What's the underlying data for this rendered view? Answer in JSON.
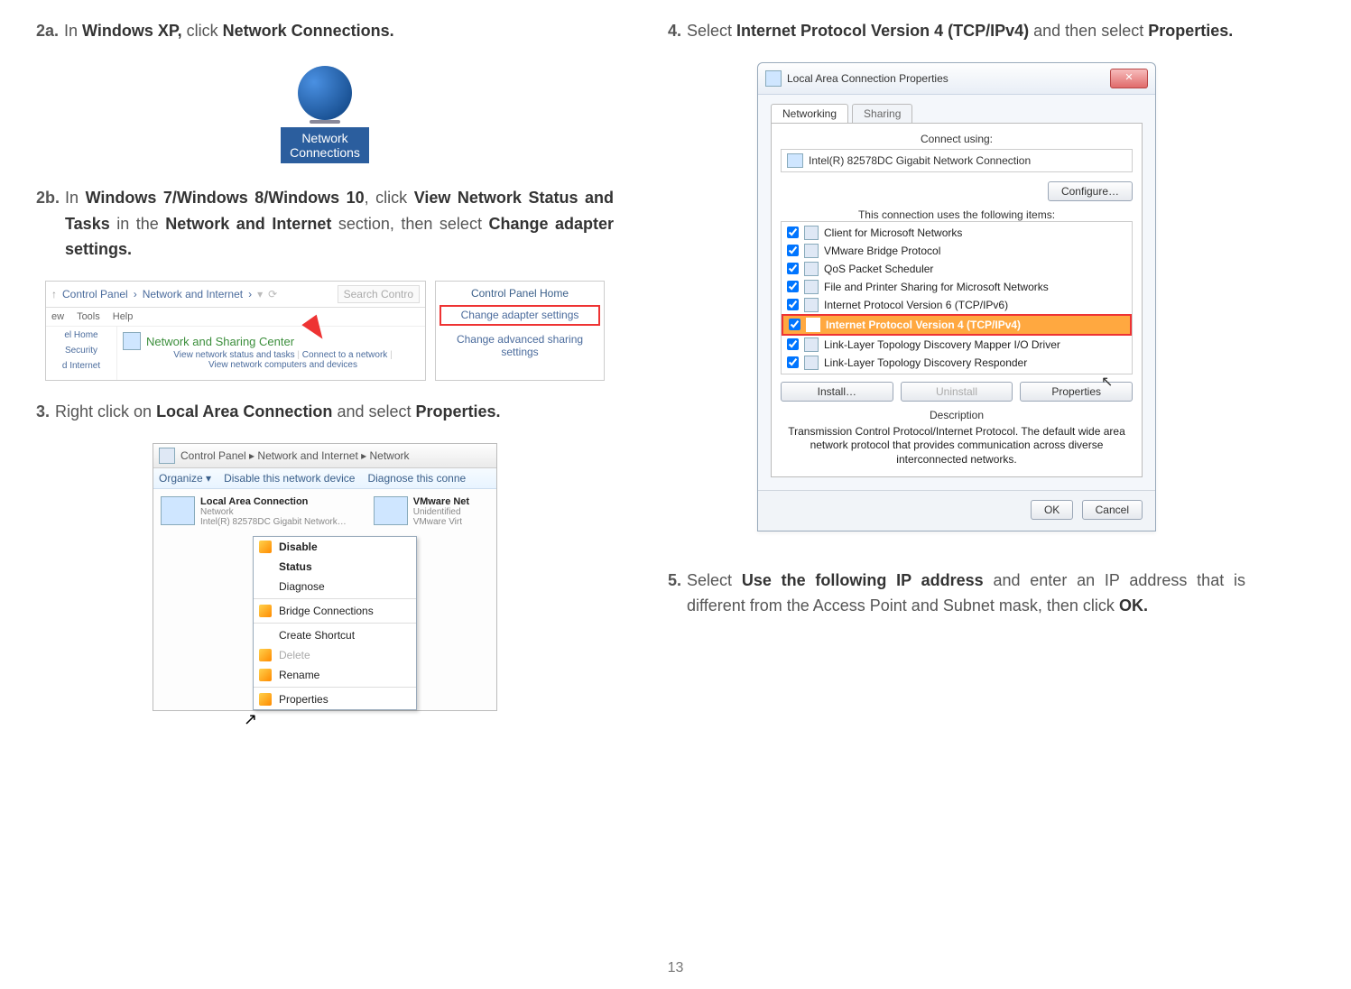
{
  "step2a": {
    "num": "2a.",
    "prefix": "In ",
    "b1": "Windows XP,",
    "mid": " click ",
    "b2": "Network Connections."
  },
  "netconn": {
    "label1": "Network",
    "label2": "Connections"
  },
  "step2b": {
    "num": "2b.",
    "prefix": "In ",
    "b1": "Windows 7/Windows 8/Windows 10",
    "mid1": ", click ",
    "b2": "View Network Status and Tasks",
    "mid2": " in the ",
    "b3": "Network and Internet",
    "mid3": " section, then select ",
    "b4": "Change adapter settings."
  },
  "cp": {
    "crumb1": "Control Panel",
    "crumb2": "Network and Internet",
    "search": "Search Contro",
    "menu_ew": "ew",
    "menu_tools": "Tools",
    "menu_help": "Help",
    "side_home": "el Home",
    "side_sec": "Security",
    "side_intr": "d Internet",
    "ns_title": "Network and Sharing Center",
    "ns_sub1": "View network status and tasks",
    "ns_sub2": "Connect to a network",
    "ns_sub3": "View network computers and devices",
    "r_hdr": "Control Panel Home",
    "r_item1": "Change adapter settings",
    "r_item2": "Change advanced sharing settings"
  },
  "step3": {
    "num": "3.",
    "prefix": "Right click on ",
    "b1": "Local Area Connection",
    "mid": " and select ",
    "b2": "Properties."
  },
  "lan": {
    "crumb": "Control Panel  ▸  Network and Internet  ▸  Network",
    "org": "Organize ▾",
    "dis": "Disable this network device",
    "diag": "Diagnose this conne",
    "left_title": "Local Area Connection",
    "left_sub1": "Network",
    "left_sub2": "Intel(R) 82578DC Gigabit Network…",
    "r_title": "VMware Net",
    "r_sub1": "Unidentified",
    "r_sub2": "VMware Virt",
    "cm_disable": "Disable",
    "cm_status": "Status",
    "cm_diagnose": "Diagnose",
    "cm_bridge": "Bridge Connections",
    "cm_shortcut": "Create Shortcut",
    "cm_delete": "Delete",
    "cm_rename": "Rename",
    "cm_props": "Properties"
  },
  "step4": {
    "num": "4.",
    "prefix": "Select ",
    "b1": "Internet Protocol Version 4 (TCP/IPv4)",
    "mid": " and then select ",
    "b2": "Properties."
  },
  "dlg": {
    "title": "Local Area Connection Properties",
    "close": "✕",
    "tab1": "Networking",
    "tab2": "Sharing",
    "connect_using": "Connect using:",
    "adapter": "Intel(R) 82578DC Gigabit Network Connection",
    "configure": "Configure…",
    "uses": "This connection uses the following items:",
    "items": [
      "Client for Microsoft Networks",
      "VMware Bridge Protocol",
      "QoS Packet Scheduler",
      "File and Printer Sharing for Microsoft Networks",
      "Internet Protocol Version 6 (TCP/IPv6)",
      "Internet Protocol Version 4 (TCP/IPv4)",
      "Link-Layer Topology Discovery Mapper I/O Driver",
      "Link-Layer Topology Discovery Responder"
    ],
    "install": "Install…",
    "uninstall": "Uninstall",
    "properties": "Properties",
    "desc_label": "Description",
    "desc_text": "Transmission Control Protocol/Internet Protocol. The default wide area network protocol that provides communication across diverse interconnected networks.",
    "ok": "OK",
    "cancel": "Cancel"
  },
  "step5": {
    "num": "5.",
    "prefix": "Select ",
    "b1": "Use the following IP address",
    "mid": " and enter an IP address that is different from the Access Point and Subnet mask, then click ",
    "b2": "OK."
  },
  "pagenum": "13"
}
